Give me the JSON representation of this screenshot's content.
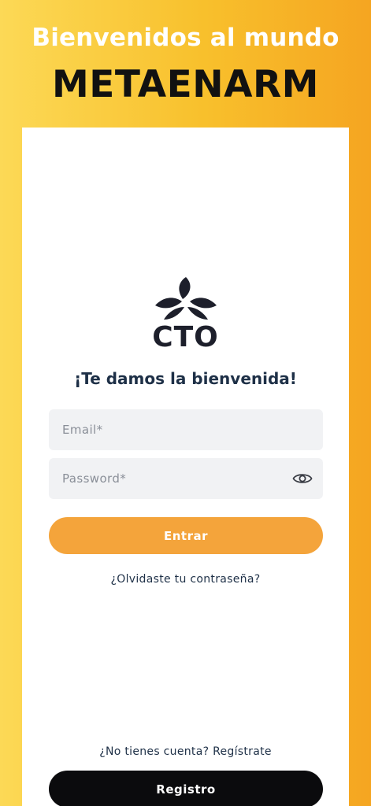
{
  "hero": {
    "line1": "Bienvenidos al mundo",
    "line2": "METAENARM"
  },
  "logo": {
    "icon": "cto-logo-icon",
    "text": "CTO"
  },
  "login": {
    "welcome": "¡Te damos la bienvenida!",
    "email_placeholder": "Email*",
    "password_placeholder": "Password*",
    "password_toggle_icon": "eye-icon",
    "submit_label": "Entrar",
    "forgot_label": "¿Olvidaste tu contraseña?"
  },
  "register": {
    "prompt": "¿No tienes cuenta? Regístrate",
    "button_label": "Registro"
  },
  "colors": {
    "background_left": "#fcd956",
    "background_right": "#f5a521",
    "primary_button": "#f4a43b",
    "dark_button": "#0b0b0d",
    "text_dark": "#1e3047"
  }
}
